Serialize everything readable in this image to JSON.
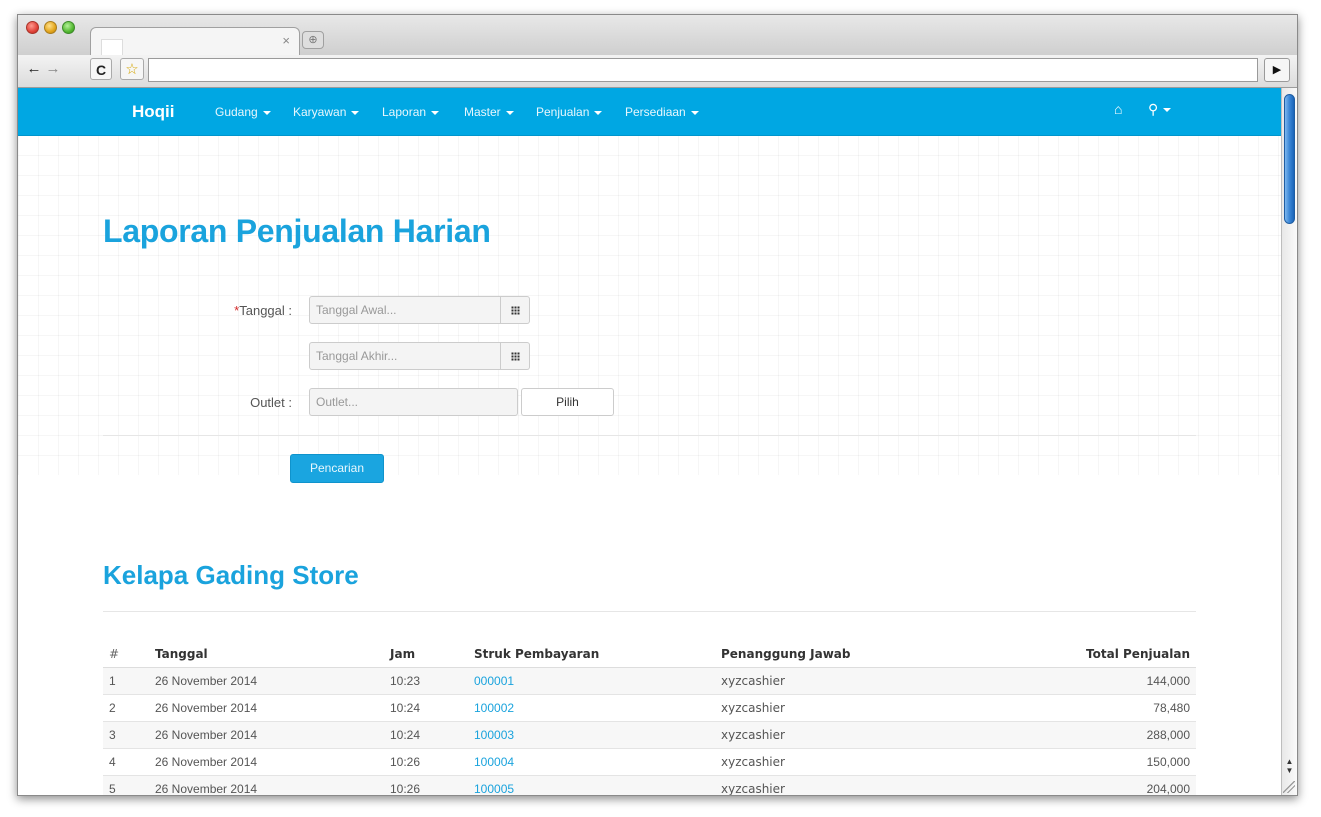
{
  "browser": {
    "tab_title": "",
    "tab_close": "×",
    "new_tab": "⊕",
    "back": "←",
    "forward": "→",
    "reload": "C",
    "star": "☆",
    "url": "",
    "page_action": "▶"
  },
  "navbar": {
    "brand": "Hoqii",
    "items": [
      "Gudang",
      "Karyawan",
      "Laporan",
      "Master",
      "Penjualan",
      "Persediaan"
    ],
    "home_icon": "⌂",
    "user_icon": "⚲"
  },
  "page": {
    "title": "Laporan Penjualan Harian"
  },
  "form": {
    "required_mark": "*",
    "tanggal_label": "Tanggal :",
    "tanggal_awal_placeholder": "Tanggal Awal...",
    "tanggal_akhir_placeholder": "Tanggal Akhir...",
    "outlet_label": "Outlet :",
    "outlet_placeholder": "Outlet...",
    "pilih_label": "Pilih",
    "search_label": "Pencarian"
  },
  "report": {
    "store_title": "Kelapa Gading Store",
    "columns": [
      "#",
      "Tanggal",
      "Jam",
      "Struk Pembayaran",
      "Penanggung Jawab",
      "Total Penjualan"
    ],
    "rows": [
      {
        "no": "1",
        "tanggal": "26 November 2014",
        "jam": "10:23",
        "struk": "000001",
        "pj": "xyzcashier",
        "total": "144,000"
      },
      {
        "no": "2",
        "tanggal": "26 November 2014",
        "jam": "10:24",
        "struk": "100002",
        "pj": "xyzcashier",
        "total": "78,480"
      },
      {
        "no": "3",
        "tanggal": "26 November 2014",
        "jam": "10:24",
        "struk": "100003",
        "pj": "xyzcashier",
        "total": "288,000"
      },
      {
        "no": "4",
        "tanggal": "26 November 2014",
        "jam": "10:26",
        "struk": "100004",
        "pj": "xyzcashier",
        "total": "150,000"
      },
      {
        "no": "5",
        "tanggal": "26 November 2014",
        "jam": "10:26",
        "struk": "100005",
        "pj": "xyzcashier",
        "total": "204,000"
      }
    ]
  },
  "colors": {
    "navbar": "#00a7e3",
    "heading": "#1aa3dd",
    "link": "#1aa3dd",
    "required": "#d32a2a"
  }
}
